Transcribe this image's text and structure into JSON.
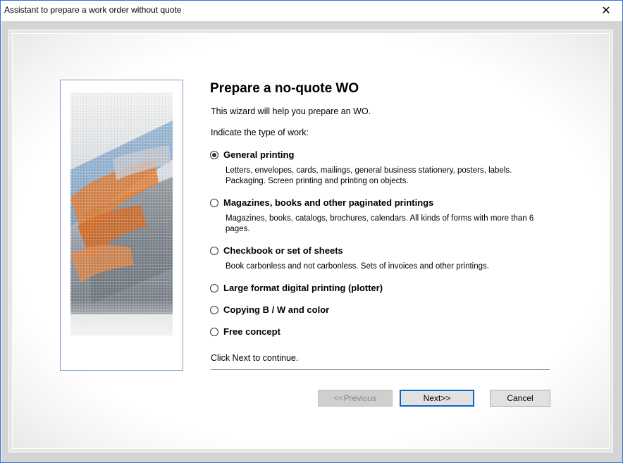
{
  "window": {
    "title": "Assistant to prepare a work order without quote",
    "close_glyph": "✕"
  },
  "wizard": {
    "heading": "Prepare a no-quote WO",
    "intro": "This wizard will help you prepare an WO.",
    "prompt": "Indicate the type of work:",
    "selected_index": 0,
    "options": [
      {
        "label": "General printing",
        "description": "Letters, envelopes, cards, mailings, general business stationery, posters, labels. Packaging. Screen printing and printing on objects."
      },
      {
        "label": "Magazines, books and other paginated printings",
        "description": "Magazines, books, catalogs, brochures, calendars. All kinds of forms with more than 6 pages."
      },
      {
        "label": "Checkbook or set of sheets",
        "description": "Book carbonless and not carbonless. Sets of invoices and other printings."
      },
      {
        "label": "Large format digital printing (plotter)",
        "description": ""
      },
      {
        "label": "Copying B / W and color",
        "description": ""
      },
      {
        "label": "Free concept",
        "description": ""
      }
    ],
    "footer": "Click Next to continue."
  },
  "buttons": {
    "previous": "<<Previous",
    "next": "Next>>",
    "cancel": "Cancel"
  },
  "colors": {
    "window_border": "#2b79d6",
    "focus_border": "#0a64c8",
    "image_panel_border": "#7a9cc6"
  }
}
